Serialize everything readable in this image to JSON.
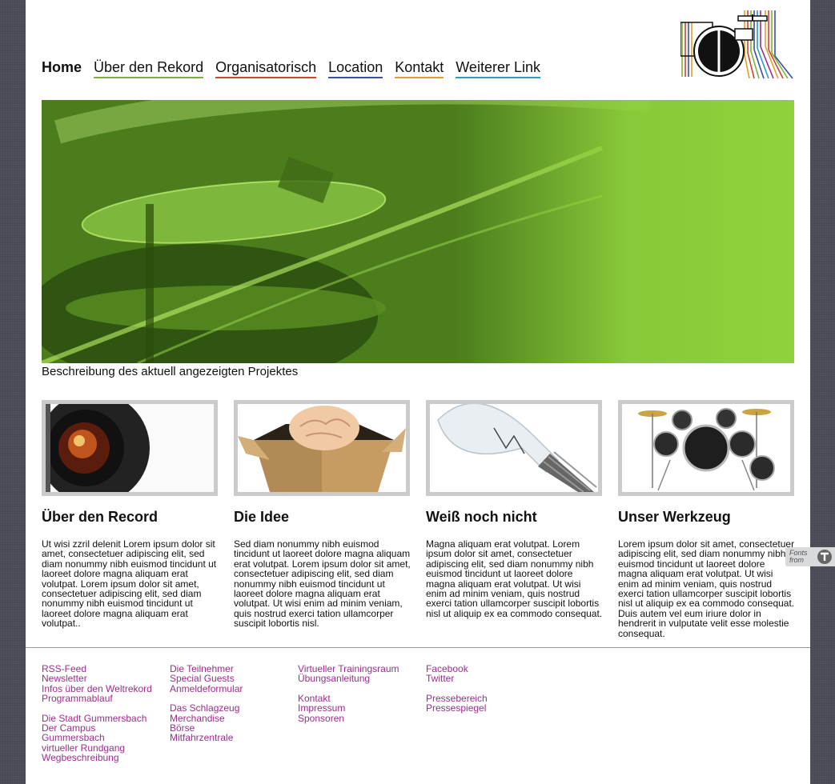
{
  "nav": {
    "items": [
      {
        "label": "Home",
        "color": ""
      },
      {
        "label": "Über den Rekord",
        "color": "#7fb238"
      },
      {
        "label": "Organisatorisch",
        "color": "#d0432e"
      },
      {
        "label": "Location",
        "color": "#3b4fa8"
      },
      {
        "label": "Kontakt",
        "color": "#e0a02a"
      },
      {
        "label": "Weiterer Link",
        "color": "#2e9bbf"
      }
    ]
  },
  "hero": {
    "caption": "Beschreibung des aktuell angezeigten Projektes",
    "accent": "#90d13c"
  },
  "cards": [
    {
      "title": "Über den Record",
      "image": "camera-lens",
      "text": "Ut wisi zzril delenit Lorem ipsum dolor sit amet, consectetuer adipiscing elit, sed diam nonummy nibh euismod tincidunt ut laoreet dolore magna aliquam erat volutpat. Lorem ipsum dolor sit amet, consectetuer adipiscing elit, sed diam nonummy nibh euismod tincidunt ut laoreet dolore magna aliquam erat volutpat.."
    },
    {
      "title": "Die Idee",
      "image": "brain-in-box",
      "text": "Sed diam nonummy nibh euismod tincidunt ut laoreet dolore magna aliquam erat volutpat. Lorem ipsum dolor sit amet, consectetuer adipiscing elit, sed diam nonummy nibh euismod tincidunt ut laoreet dolore magna aliquam erat volutpat. Ut wisi enim ad minim veniam, quis nostrud exerci tation ullamcorper suscipit lobortis nisl."
    },
    {
      "title": "Weiß noch nicht",
      "image": "light-bulb",
      "text": "Magna aliquam erat volutpat. Lorem ipsum dolor sit amet, consectetuer adipiscing elit, sed diam nonummy nibh euismod tincidunt ut laoreet dolore magna aliquam erat volutpat. Ut wisi enim ad minim veniam, quis nostrud exerci tation ullamcorper suscipit lobortis nisl ut aliquip ex ea commodo consequat."
    },
    {
      "title": "Unser Werkzeug",
      "image": "drum-kit",
      "text": "Lorem ipsum dolor sit amet, consectetuer adipiscing elit, sed diam nonummy nibh euismod tincidunt ut laoreet dolore magna aliquam erat volutpat. Ut wisi enim ad minim veniam, quis nostrud exerci tation ullamcorper suscipit lobortis nisl ut aliquip ex ea commodo consequat. Duis autem vel eum iriure dolor in hendrerit in vulputate velit esse molestie consequat."
    }
  ],
  "footer": {
    "link_color": "#9b2d8c",
    "col1a": [
      "RSS-Feed",
      "Newsletter",
      "Infos über den Weltrekord",
      "Programmablauf"
    ],
    "col1b": [
      "Die Stadt Gummersbach",
      "Der Campus Gummersbach",
      "virtueller Rundgang",
      "Wegbeschreibung"
    ],
    "col2a": [
      "Die Teilnehmer",
      "Special Guests",
      "Anmeldeformular"
    ],
    "col2b": [
      "Das Schlagzeug",
      "Merchandise",
      "Börse",
      "Mitfahrzentrale"
    ],
    "col3a": [
      "Virtueller Trainingsraum",
      "Übungsanleitung"
    ],
    "col3b": [
      "Kontakt",
      "Impressum",
      "Sponsoren"
    ],
    "col4a": [
      "Facebook",
      "Twitter"
    ],
    "col4b": [
      "Pressebereich",
      "Pressespiegel"
    ]
  },
  "badge": {
    "line1": "Fonts",
    "line2": "from"
  }
}
